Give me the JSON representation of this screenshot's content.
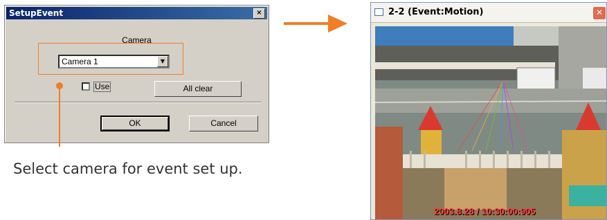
{
  "dialog": {
    "title": "SetupEvent",
    "close_glyph": "×",
    "camera_label": "Camera",
    "camera_select_value": "Camera 1",
    "dropdown_glyph": "▼",
    "use_label": "Use",
    "use_checked": false,
    "all_clear_label": "All clear",
    "ok_label": "OK",
    "cancel_label": "Cancel"
  },
  "annotation": {
    "caption": "Select camera for event set up.",
    "accent_color": "#f07e26"
  },
  "camera_window": {
    "title": "2-2 (Event:Motion)",
    "close_glyph": "✕",
    "timestamp": "2003.8.28 / 10:30:00:905"
  },
  "icons": [
    "close-icon",
    "dropdown-arrow-icon",
    "arrow-right-icon",
    "window-icon"
  ]
}
